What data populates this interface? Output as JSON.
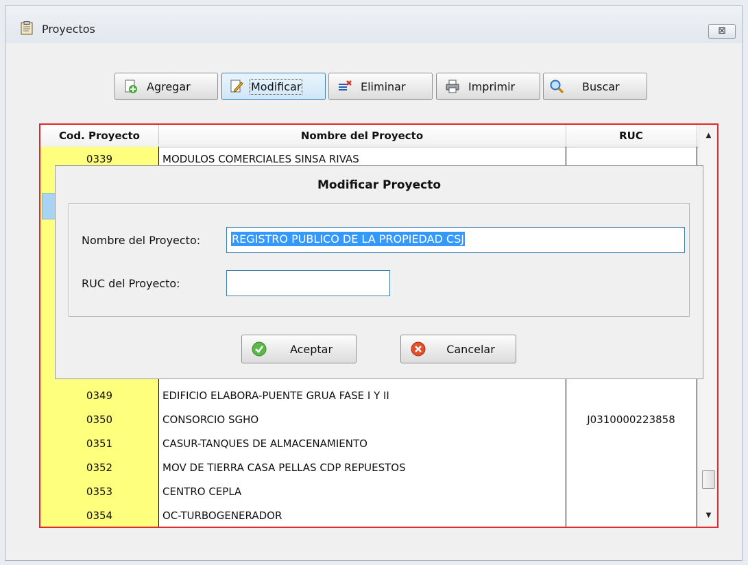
{
  "window": {
    "title": "Proyectos",
    "close_label": "⊠"
  },
  "toolbar": {
    "agregar": "Agregar",
    "modificar": "Modificar",
    "eliminar": "Eliminar",
    "imprimir": "Imprimir",
    "buscar": "Buscar"
  },
  "grid": {
    "headers": [
      "Cod. Proyecto",
      "Nombre del Proyecto",
      "RUC"
    ],
    "top_row": {
      "code": "0339",
      "name": "MODULOS COMERCIALES SINSA RIVAS",
      "ruc": ""
    },
    "rows": [
      {
        "code": "0349",
        "name": "EDIFICIO ELABORA-PUENTE GRUA FASE I Y II",
        "ruc": ""
      },
      {
        "code": "0350",
        "name": "CONSORCIO SGHO",
        "ruc": "J0310000223858"
      },
      {
        "code": "0351",
        "name": "CASUR-TANQUES DE ALMACENAMIENTO",
        "ruc": ""
      },
      {
        "code": "0352",
        "name": "MOV DE TIERRA CASA PELLAS CDP REPUESTOS",
        "ruc": ""
      },
      {
        "code": "0353",
        "name": "CENTRO CEPLA",
        "ruc": ""
      },
      {
        "code": "0354",
        "name": "OC-TURBOGENERADOR",
        "ruc": ""
      }
    ]
  },
  "dialog": {
    "title": "Modificar Proyecto",
    "name_label": "Nombre del Proyecto:",
    "name_value": "REGISTRO PUBLICO DE LA PROPIEDAD CSJ",
    "ruc_label": "RUC del Proyecto:",
    "ruc_value": "",
    "accept": "Aceptar",
    "cancel": "Cancelar"
  },
  "colors": {
    "grid_border": "#e02a2a",
    "code_column": "#ffff7e",
    "selection": "#3399ff"
  }
}
